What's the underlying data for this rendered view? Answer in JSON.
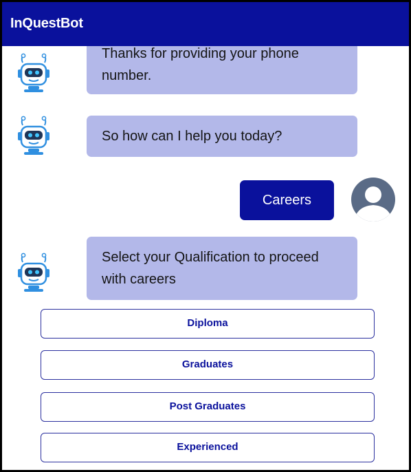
{
  "header": {
    "title": "InQuestBot"
  },
  "messages": [
    {
      "from": "bot",
      "text": "Thanks for providing your phone number."
    },
    {
      "from": "bot",
      "text": "So how can I help you today?"
    },
    {
      "from": "user",
      "text": "Careers"
    },
    {
      "from": "bot",
      "text": "Select your Qualification to proceed with careers"
    }
  ],
  "options": [
    {
      "label": "Diploma"
    },
    {
      "label": "Graduates"
    },
    {
      "label": "Post Graduates"
    },
    {
      "label": "Experienced"
    }
  ],
  "colors": {
    "header_bg": "#0a119c",
    "bot_bubble": "#b3b8e9",
    "user_bubble": "#0a119c",
    "option_border": "#2a2f9e"
  },
  "icons": {
    "bot": "robot-icon",
    "user": "user-avatar-icon"
  }
}
